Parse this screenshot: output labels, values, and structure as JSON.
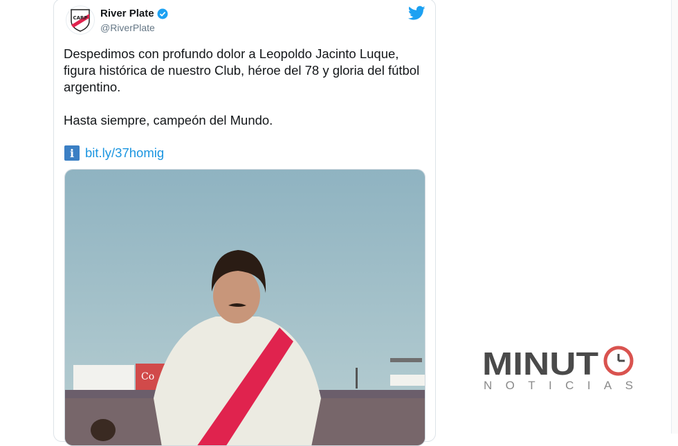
{
  "tweet": {
    "display_name": "River Plate",
    "handle": "@RiverPlate",
    "avatar_icon": "river-plate-crest-icon",
    "verified_icon": "verified-badge-icon",
    "brand_icon": "twitter-bird-icon",
    "paragraph_1": "Despedimos con profundo dolor a Leopoldo Jacinto Luque, figura histórica de nuestro Club, héroe del 78 y gloria del fútbol argentino.",
    "paragraph_2": "Hasta siempre, campeón del Mundo.",
    "link": "bit.ly/37homig",
    "link_icon": "info-icon",
    "media": "photo"
  },
  "brand": {
    "word_1": "MINUT",
    "word_2": "NOTICIAS",
    "clock_icon": "clock-icon"
  },
  "colors": {
    "twitter_blue": "#1da1f2",
    "link_blue": "#1b95e0",
    "logo_dark": "#4a4a4a",
    "logo_red": "#d9534f",
    "river_red": "#e0234e"
  }
}
